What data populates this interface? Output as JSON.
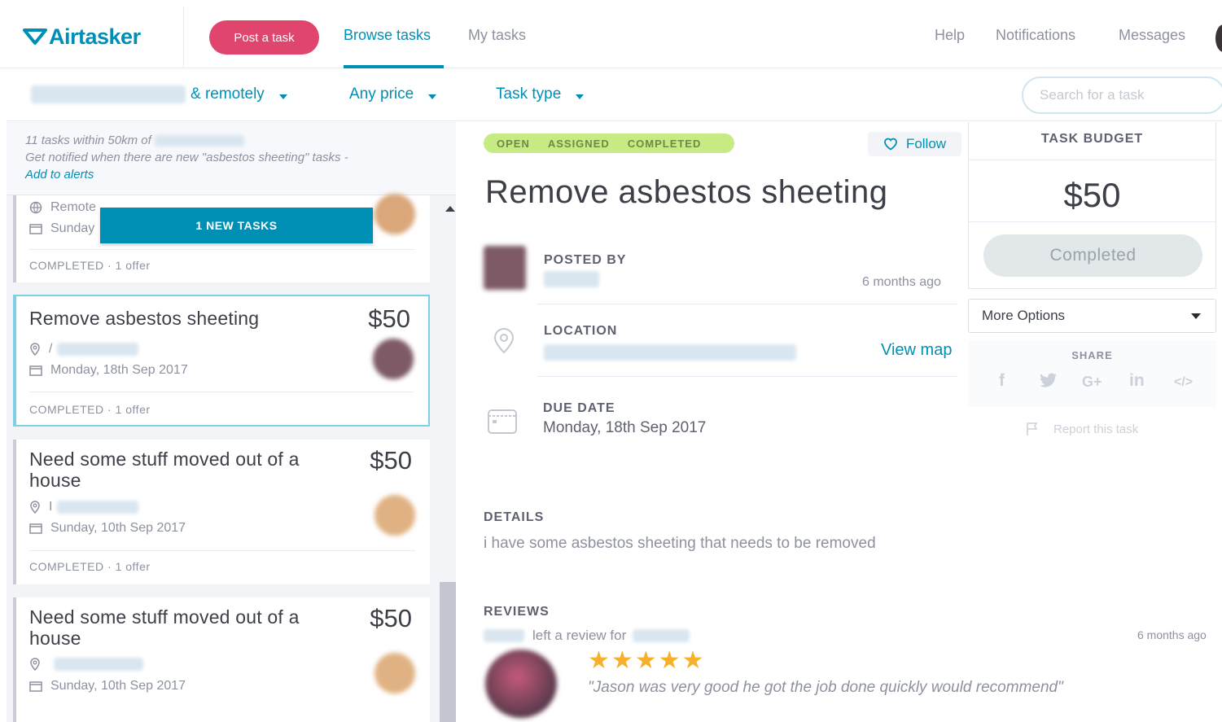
{
  "header": {
    "logo": "Airtasker",
    "post_task": "Post a task",
    "nav": {
      "browse": "Browse tasks",
      "my_tasks": "My tasks"
    },
    "right_nav": {
      "help": "Help",
      "notifications": "Notifications",
      "messages": "Messages"
    }
  },
  "filters": {
    "location_suffix": "& remotely",
    "price": "Any price",
    "task_type": "Task type",
    "search_placeholder": "Search for a task"
  },
  "list": {
    "info_line1": "11 tasks within 50km of",
    "info_line2": "Get notified when there are new \"asbestos sheeting\" tasks -",
    "alerts_link": "Add to alerts",
    "new_tasks_banner": "1 NEW TASKS",
    "cards": [
      {
        "title": "",
        "price": "",
        "location": "Remote",
        "date": "Sunday",
        "status": "COMPLETED",
        "offers": "1 offer"
      },
      {
        "title": "Remove asbestos sheeting",
        "price": "$50",
        "location": "/",
        "date": "Monday, 18th Sep 2017",
        "status": "COMPLETED",
        "offers": "1 offer"
      },
      {
        "title": "Need some stuff moved out of a house",
        "price": "$50",
        "location": "I",
        "date": "Sunday, 10th Sep 2017",
        "status": "COMPLETED",
        "offers": "1 offer"
      },
      {
        "title": "Need some stuff moved out of a house",
        "price": "$50",
        "location": "",
        "date": "Sunday, 10th Sep 2017",
        "status": "COMPLETED",
        "offers": "1 offer"
      }
    ]
  },
  "task": {
    "status_steps": [
      "OPEN",
      "ASSIGNED",
      "COMPLETED"
    ],
    "follow": "Follow",
    "title": "Remove asbestos sheeting",
    "posted_by_label": "POSTED BY",
    "posted_ago": "6 months ago",
    "location_label": "LOCATION",
    "view_map": "View map",
    "due_date_label": "DUE DATE",
    "due_date": "Monday, 18th Sep 2017",
    "details_label": "DETAILS",
    "details": "i have some asbestos sheeting that needs to be removed",
    "reviews_label": "REVIEWS",
    "review_mid": "left a review for",
    "review_time": "6 months ago",
    "review_stars": 5,
    "review_text": "\"Jason was very good he got the job done quickly would recommend\""
  },
  "sidebar": {
    "budget_label": "TASK BUDGET",
    "budget": "$50",
    "completed": "Completed",
    "more_options": "More Options",
    "share_label": "SHARE",
    "share_icons": [
      "facebook-icon",
      "twitter-icon",
      "google-plus-icon",
      "linkedin-icon",
      "embed-icon"
    ],
    "report": "Report this task"
  },
  "colors": {
    "brand": "#008fb4",
    "post_button": "#e0466d",
    "status_pill": "#c6eb85",
    "star": "#f6b02a"
  }
}
